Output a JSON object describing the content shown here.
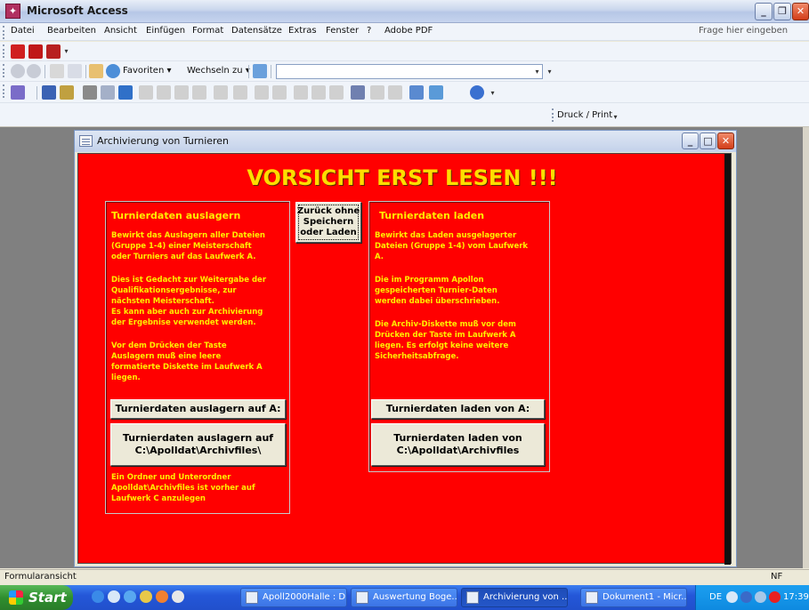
{
  "window": {
    "title": "Microsoft Access",
    "app_icon": "access-key-icon"
  },
  "menu": {
    "items": [
      "Datei",
      "Bearbeiten",
      "Ansicht",
      "Einfügen",
      "Format",
      "Datensätze",
      "Extras",
      "Fenster",
      "?",
      "Adobe PDF"
    ],
    "help_placeholder": "Frage hier eingeben"
  },
  "toolbar_web": {
    "favorites_label": "Favoriten ▾",
    "goto_label": "Wechseln zu ▾"
  },
  "toolbar_print": {
    "label": "Druck / Print"
  },
  "form": {
    "title": "Archivierung von Turnieren",
    "headline": "VORSICHT ERST LESEN !!!",
    "back_button": "Zurück ohne\nSpeichern\noder Laden",
    "left_panel": {
      "title": "Turnierdaten auslagern",
      "p1": "Bewirkt das Auslagern aller Dateien\n(Gruppe 1-4) einer Meisterschaft\noder Turniers auf das Laufwerk A.",
      "p2": "Dies ist Gedacht zur Weitergabe der\nQualifikationsergebnisse, zur\nnächsten Meisterschaft.\nEs kann aber auch zur Archivierung\nder Ergebnise verwendet werden.",
      "p3": "Vor dem Drücken der Taste\nAuslagern muß eine leere\nformatierte  Diskette im Laufwerk A\nliegen.",
      "button_a": "Turnierdaten auslagern auf A:",
      "button_c": "Turnierdaten auslagern auf\nC:\\Apolldat\\Archivfiles\\",
      "note": "Ein Ordner und Unterordner\nApolldat\\Archivfiles ist vorher auf\nLaufwerk C anzulegen"
    },
    "right_panel": {
      "title": "Turnierdaten laden",
      "p1": "Bewirkt das Laden ausgelagerter\nDateien (Gruppe 1-4) vom Laufwerk\nA.",
      "p2": "Die im Programm Apollon\ngespeicherten Turnier-Daten\nwerden dabei überschrieben.",
      "p3": "Die Archiv-Diskette muß vor dem\nDrücken der Taste im Laufwerk A\nliegen. Es erfolgt keine weitere\nSicherheitsabfrage.",
      "button_a": "Turnierdaten laden von A:",
      "button_c": "Turnierdaten laden von\nC:\\Apolldat\\Archivfiles"
    }
  },
  "statusbar": {
    "mode": "Formularansicht",
    "indicator": "NF"
  },
  "taskbar": {
    "start_label": "Start",
    "tasks": [
      "Apoll2000Halle : D...",
      "Auswertung Boge...",
      "Archivierung von ...",
      "Dokument1 - Micr..."
    ],
    "active_task": "Archivierung von ...",
    "tray_lang": "DE",
    "clock": "17:39"
  },
  "colors": {
    "form_background": "#ff0000",
    "headline": "#ffdd00",
    "panel_text": "#ffee00"
  }
}
